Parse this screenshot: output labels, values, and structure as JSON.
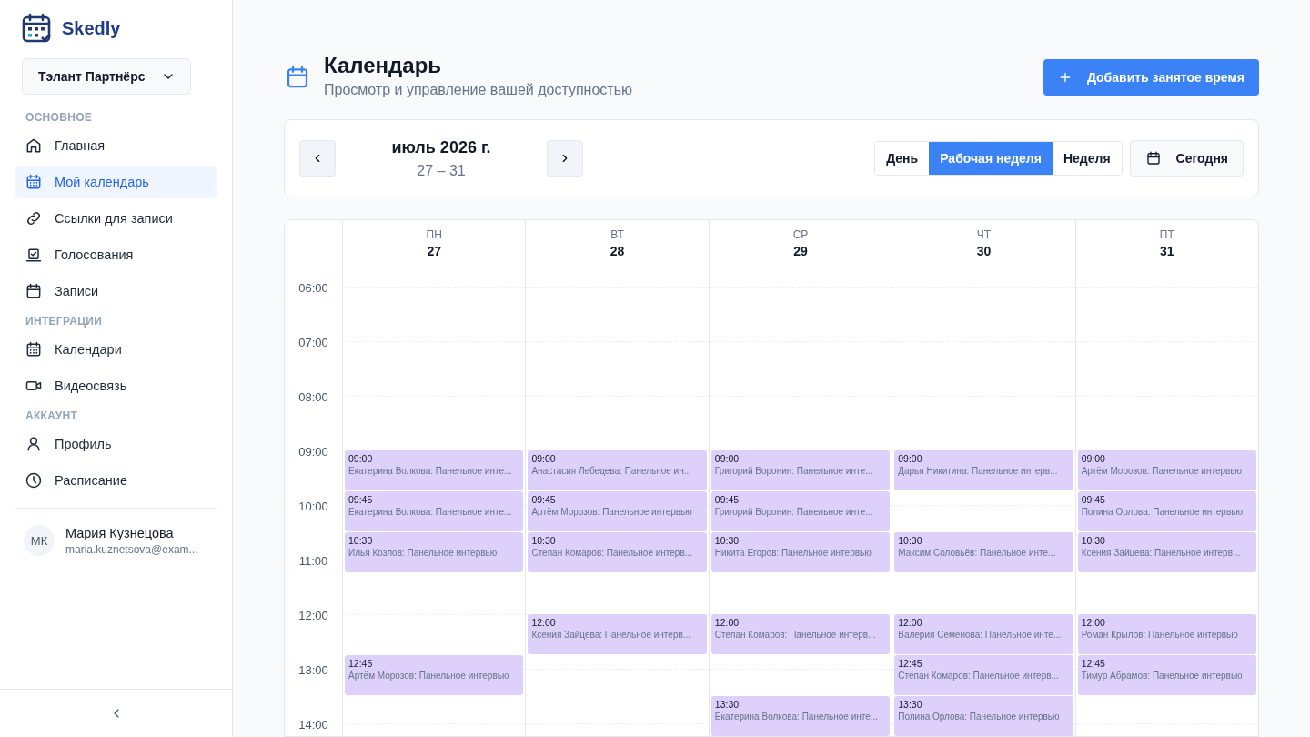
{
  "sidebar": {
    "brand": "Skedly",
    "workspace": "Тэлант Партнёрс",
    "sections": [
      {
        "title": "ОСНОВНОЕ",
        "items": [
          {
            "label": "Главная",
            "kind": "home",
            "selected": false
          },
          {
            "label": "Мой календарь",
            "kind": "calendar",
            "selected": true
          },
          {
            "label": "Ссылки для записи",
            "kind": "link",
            "selected": false
          },
          {
            "label": "Голосования",
            "kind": "vote",
            "selected": false
          },
          {
            "label": "Записи",
            "kind": "bookings",
            "selected": false
          }
        ]
      },
      {
        "title": "ИНТЕГРАЦИИ",
        "items": [
          {
            "label": "Календари",
            "kind": "calendar",
            "selected": false
          },
          {
            "label": "Видеосвязь",
            "kind": "video",
            "selected": false
          }
        ]
      },
      {
        "title": "АККАУНТ",
        "items": [
          {
            "label": "Профиль",
            "kind": "user",
            "selected": false
          },
          {
            "label": "Расписание",
            "kind": "clock",
            "selected": false
          }
        ]
      }
    ],
    "user": {
      "initials": "МК",
      "name": "Мария Кузнецова",
      "email": "maria.kuznetsova@exam..."
    }
  },
  "header": {
    "title": "Календарь",
    "subtitle": "Просмотр и управление вашей доступностью",
    "add_button": "Добавить занятое время"
  },
  "toolbar": {
    "month": "июль 2026 г.",
    "range": "27 – 31",
    "views": [
      {
        "label": "День",
        "selected": false
      },
      {
        "label": "Рабочая неделя",
        "selected": true
      },
      {
        "label": "Неделя",
        "selected": false
      }
    ],
    "today": "Сегодня"
  },
  "hours": [
    "06:00",
    "07:00",
    "08:00",
    "09:00",
    "10:00",
    "11:00",
    "12:00",
    "13:00",
    "14:00"
  ],
  "days": [
    {
      "weekday": "ПН",
      "date": "27",
      "events": [
        {
          "time": "09:00",
          "title": "Екатерина Волкова: Панельное инте..."
        },
        {
          "time": "09:45",
          "title": "Екатерина Волкова: Панельное инте..."
        },
        {
          "time": "10:30",
          "title": "Илья Козлов: Панельное интервью"
        },
        {
          "time": "12:45",
          "title": "Артём Морозов: Панельное интервью"
        }
      ]
    },
    {
      "weekday": "ВТ",
      "date": "28",
      "events": [
        {
          "time": "09:00",
          "title": "Анастасия Лебедева: Панельное ин..."
        },
        {
          "time": "09:45",
          "title": "Артём Морозов: Панельное интервью"
        },
        {
          "time": "10:30",
          "title": "Степан Комаров: Панельное интерв..."
        },
        {
          "time": "12:00",
          "title": "Ксения Зайцева: Панельное интерв..."
        }
      ]
    },
    {
      "weekday": "СР",
      "date": "29",
      "events": [
        {
          "time": "09:00",
          "title": "Григорий Воронин: Панельное инте..."
        },
        {
          "time": "09:45",
          "title": "Григорий Воронин: Панельное инте..."
        },
        {
          "time": "10:30",
          "title": "Никита Егоров: Панельное интервью"
        },
        {
          "time": "12:00",
          "title": "Степан Комаров: Панельное интерв..."
        },
        {
          "time": "13:30",
          "title": "Екатерина Волкова: Панельное инте..."
        }
      ]
    },
    {
      "weekday": "ЧТ",
      "date": "30",
      "events": [
        {
          "time": "09:00",
          "title": "Дарья Никитина: Панельное интерв..."
        },
        {
          "time": "10:30",
          "title": "Максим Соловьёв: Панельное инте..."
        },
        {
          "time": "12:00",
          "title": "Валерия Семёнова: Панельное инте..."
        },
        {
          "time": "12:45",
          "title": "Степан Комаров: Панельное интерв..."
        },
        {
          "time": "13:30",
          "title": "Полина Орлова: Панельное интервью"
        }
      ]
    },
    {
      "weekday": "ПТ",
      "date": "31",
      "events": [
        {
          "time": "09:00",
          "title": "Артём Морозов: Панельное интервью"
        },
        {
          "time": "09:45",
          "title": "Полина Орлова: Панельное интервью"
        },
        {
          "time": "10:30",
          "title": "Ксения Зайцева: Панельное интерв..."
        },
        {
          "time": "12:00",
          "title": "Роман Крылов: Панельное интервью"
        },
        {
          "time": "12:45",
          "title": "Тимур Абрамов: Панельное интервью"
        }
      ]
    }
  ]
}
